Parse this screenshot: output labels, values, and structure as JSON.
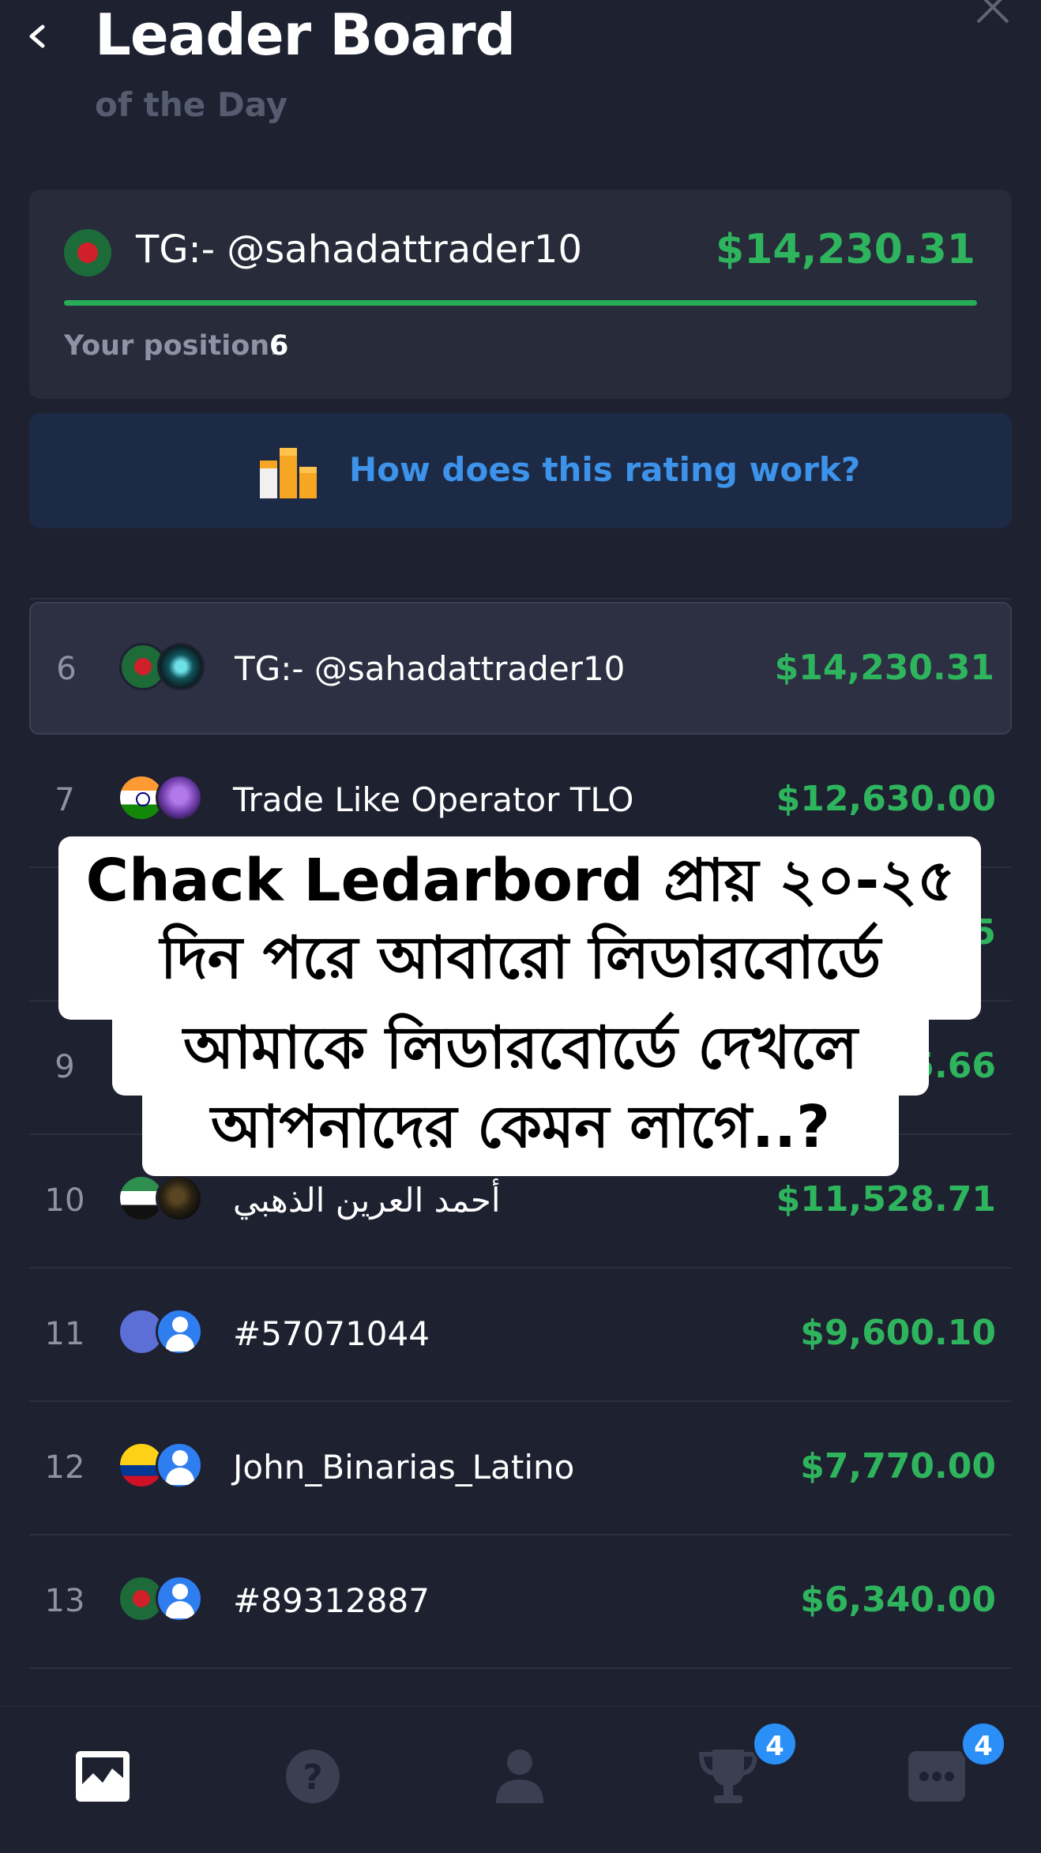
{
  "header": {
    "title": "Leader Board",
    "subtitle": "of the Day"
  },
  "me": {
    "name": "TG:- @sahadattrader10",
    "amount": "$14,230.31",
    "position_label": "Your position:",
    "position_value": "6",
    "flag_icon": "bangladesh-flag-icon",
    "progress_fraction": 1.0
  },
  "info": {
    "text": "How does this rating work?",
    "icon": "gift-boxes-icon"
  },
  "rows": [
    {
      "rank": "6",
      "name": "TG:- @sahadattrader10",
      "amount": "$14,230.31",
      "flag": "flag-bd",
      "avatar": "photo-1"
    },
    {
      "rank": "7",
      "name": "Trade Like Operator TLO",
      "amount": "$12,630.00",
      "flag": "flag-in",
      "avatar": "photo-2"
    },
    {
      "rank": "",
      "name": "",
      "amount": "5",
      "flag": "",
      "avatar": ""
    },
    {
      "rank": "9",
      "name": "",
      "amount": "5.66",
      "flag": "",
      "avatar": ""
    },
    {
      "rank": "10",
      "name": "أحمد العرين الذهبي",
      "amount": "$11,528.71",
      "flag": "flag-sy",
      "avatar": "photo-3"
    },
    {
      "rank": "11",
      "name": "#57071044",
      "amount": "$9,600.10",
      "flag": "flag-globe",
      "avatar": "user-blue"
    },
    {
      "rank": "12",
      "name": "John_Binarias_Latino",
      "amount": "$7,770.00",
      "flag": "flag-co",
      "avatar": "user-blue"
    },
    {
      "rank": "13",
      "name": "#89312887",
      "amount": "$6,340.00",
      "flag": "flag-bd",
      "avatar": "user-blue"
    }
  ],
  "overlay": {
    "lines": [
      "Chack Ledarbord প্রায় ২০-২৫",
      "দিন পরে আবারো লিডারবোর্ডে",
      "আমাকে লিডারবোর্ডে দেখলে",
      "আপনাদের কেমন লাগে..?"
    ]
  },
  "tabbar": {
    "tabs": [
      {
        "icon": "chart-icon",
        "active": true
      },
      {
        "icon": "help-icon",
        "active": false
      },
      {
        "icon": "profile-icon",
        "active": false
      },
      {
        "icon": "trophy-icon",
        "active": false,
        "badge": "4"
      },
      {
        "icon": "chat-icon",
        "active": false,
        "badge": "4"
      }
    ]
  },
  "colors": {
    "background": "#1e2130",
    "card": "#272b3a",
    "profit_green": "#2fb45e",
    "link_blue": "#3d92ea",
    "badge_blue": "#2a8ff7"
  }
}
